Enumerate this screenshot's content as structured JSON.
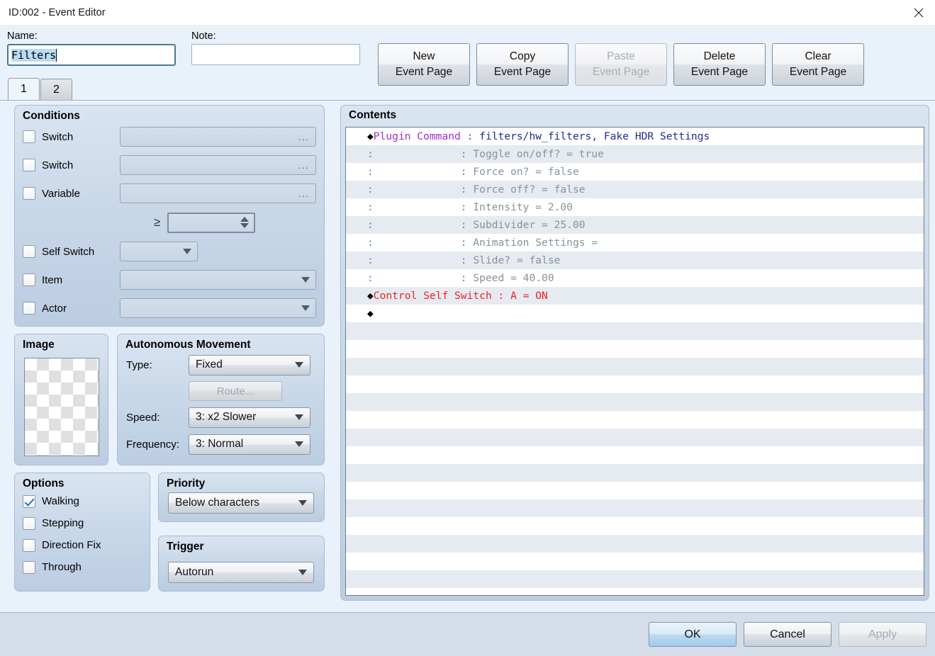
{
  "window": {
    "title": "ID:002 - Event Editor",
    "close_icon": "close-icon"
  },
  "topbar": {
    "name_label": "Name:",
    "name_value": "Filters",
    "note_label": "Note:",
    "note_value": "",
    "buttons": [
      {
        "line1": "New",
        "line2": "Event Page",
        "disabled": false
      },
      {
        "line1": "Copy",
        "line2": "Event Page",
        "disabled": false
      },
      {
        "line1": "Paste",
        "line2": "Event Page",
        "disabled": true
      },
      {
        "line1": "Delete",
        "line2": "Event Page",
        "disabled": false
      },
      {
        "line1": "Clear",
        "line2": "Event Page",
        "disabled": false
      }
    ]
  },
  "tabs": [
    {
      "label": "1",
      "active": true
    },
    {
      "label": "2",
      "active": false
    }
  ],
  "conditions": {
    "title": "Conditions",
    "rows": [
      {
        "label": "Switch",
        "checked": false,
        "control": "browse",
        "value": "..."
      },
      {
        "label": "Switch",
        "checked": false,
        "control": "browse",
        "value": "..."
      },
      {
        "label": "Variable",
        "checked": false,
        "control": "browse",
        "value": "..."
      }
    ],
    "comparator": "≥",
    "comparator_value": "",
    "rows2": [
      {
        "label": "Self Switch",
        "checked": false,
        "control": "combo-small",
        "value": ""
      },
      {
        "label": "Item",
        "checked": false,
        "control": "combo-wide",
        "value": ""
      },
      {
        "label": "Actor",
        "checked": false,
        "control": "combo-wide",
        "value": ""
      }
    ]
  },
  "image": {
    "title": "Image",
    "preview": "empty-transparent-checkerboard"
  },
  "autonomous_movement": {
    "title": "Autonomous Movement",
    "type_label": "Type:",
    "type_value": "Fixed",
    "route_button": "Route...",
    "route_disabled": true,
    "speed_label": "Speed:",
    "speed_value": "3: x2 Slower",
    "frequency_label": "Frequency:",
    "frequency_value": "3: Normal"
  },
  "options": {
    "title": "Options",
    "items": [
      {
        "label": "Walking",
        "checked": true
      },
      {
        "label": "Stepping",
        "checked": false
      },
      {
        "label": "Direction Fix",
        "checked": false
      },
      {
        "label": "Through",
        "checked": false
      }
    ]
  },
  "priority": {
    "title": "Priority",
    "value": "Below characters"
  },
  "trigger": {
    "title": "Trigger",
    "value": "Autorun"
  },
  "contents": {
    "title": "Contents",
    "lines": [
      {
        "kind": "command",
        "diamond": true,
        "indent": 0,
        "command": "Plugin Command",
        "colon": " : ",
        "value": "filters/hw_filters, Fake HDR Settings"
      },
      {
        "kind": "param",
        "diamond": false,
        "indent": 0,
        "command": ":",
        "colon": " : ",
        "value": "Toggle on/off? = true"
      },
      {
        "kind": "param",
        "diamond": false,
        "indent": 0,
        "command": ":",
        "colon": " : ",
        "value": "Force on? = false"
      },
      {
        "kind": "param",
        "diamond": false,
        "indent": 0,
        "command": ":",
        "colon": " : ",
        "value": "Force off? = false"
      },
      {
        "kind": "param",
        "diamond": false,
        "indent": 0,
        "command": ":",
        "colon": " : ",
        "value": "Intensity = 2.00"
      },
      {
        "kind": "param",
        "diamond": false,
        "indent": 0,
        "command": ":",
        "colon": " : ",
        "value": "Subdivider = 25.00"
      },
      {
        "kind": "param",
        "diamond": false,
        "indent": 0,
        "command": ":",
        "colon": " : ",
        "value": "Animation Settings ="
      },
      {
        "kind": "param",
        "diamond": false,
        "indent": 0,
        "command": ":",
        "colon": " : ",
        "value": "Slide? = false"
      },
      {
        "kind": "param",
        "diamond": false,
        "indent": 0,
        "command": ":",
        "colon": " : ",
        "value": "Speed = 40.00"
      },
      {
        "kind": "red",
        "diamond": true,
        "indent": 0,
        "command": "Control Self Switch",
        "colon": " : ",
        "value": "A = ON"
      },
      {
        "kind": "end",
        "diamond": true,
        "indent": 0,
        "command": "",
        "colon": "",
        "value": ""
      }
    ],
    "total_rows": 26
  },
  "footer": {
    "ok": "OK",
    "cancel": "Cancel",
    "apply": "Apply",
    "apply_disabled": true
  },
  "colors": {
    "dialog_bg": "#E9F1FB",
    "panel_top": "#D9E4F1",
    "panel_bottom": "#BCCDE2",
    "command_purple": "#9B30C8",
    "param_gray": "#8A9199",
    "value_navy": "#1C2E8A",
    "red": "#F0231E",
    "selection_blue": "#B9DCF5",
    "check_blue": "#2E6FC4",
    "row_stripe": "#E5EBF1"
  }
}
